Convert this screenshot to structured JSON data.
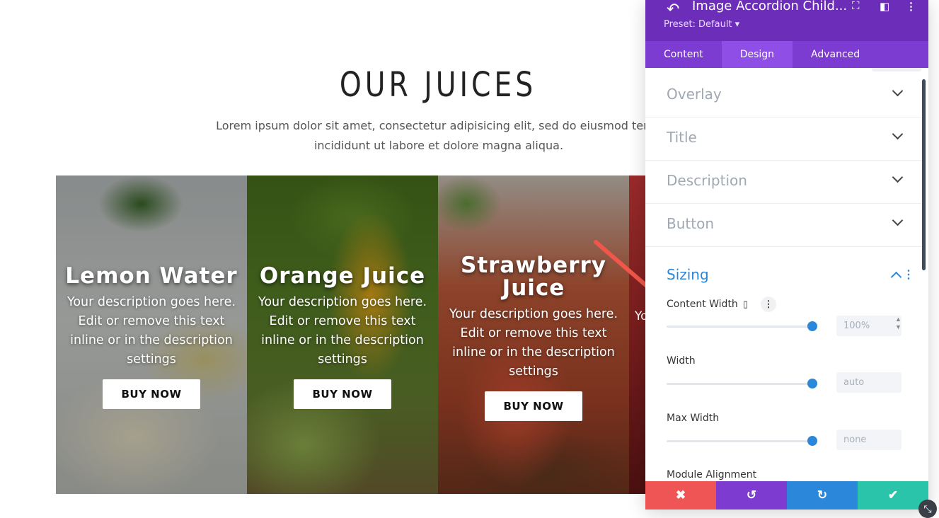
{
  "page": {
    "title": "OUR JUICES",
    "intro_line1": "Lorem ipsum dolor sit amet, consectetur adipisicing elit, sed do eiusmod temp",
    "intro_line2": "incididunt ut labore et dolore magna aliqua.",
    "panels": [
      {
        "title": "Lemon Water",
        "description": "Your description goes here. Edit or remove this text inline or in the description settings",
        "button": "BUY NOW"
      },
      {
        "title": "Orange Juice",
        "description": "Your description goes here. Edit or remove this text inline or in the description settings",
        "button": "BUY NOW"
      },
      {
        "title": "Strawberry Juice",
        "description": "Your description goes here. Edit or remove this text inline or in the description settings",
        "button": "BUY NOW"
      }
    ],
    "partial_panel_text": "Yo in"
  },
  "builder": {
    "title": "Image Accordion Child...",
    "preset": "Preset: Default ▾",
    "tabs": [
      "Content",
      "Design",
      "Advanced"
    ],
    "active_tab": "Design",
    "sections": [
      "Overlay",
      "Title",
      "Description",
      "Button"
    ],
    "sizing": {
      "title": "Sizing",
      "fields": [
        {
          "label": "Content Width",
          "value": "100%"
        },
        {
          "label": "Width",
          "value": "auto"
        },
        {
          "label": "Max Width",
          "value": "none"
        },
        {
          "label": "Module Alignment",
          "value": ""
        }
      ]
    },
    "footer_icons": [
      "close-icon",
      "undo-icon",
      "redo-icon",
      "check-icon"
    ],
    "colors": {
      "header": "#6c2eb9",
      "tab_active": "#8f4fe6",
      "accent": "#2b87da",
      "cancel": "#ef5555",
      "undo": "#7e3bd0",
      "redo": "#2b87da",
      "save": "#29c4a9"
    }
  }
}
